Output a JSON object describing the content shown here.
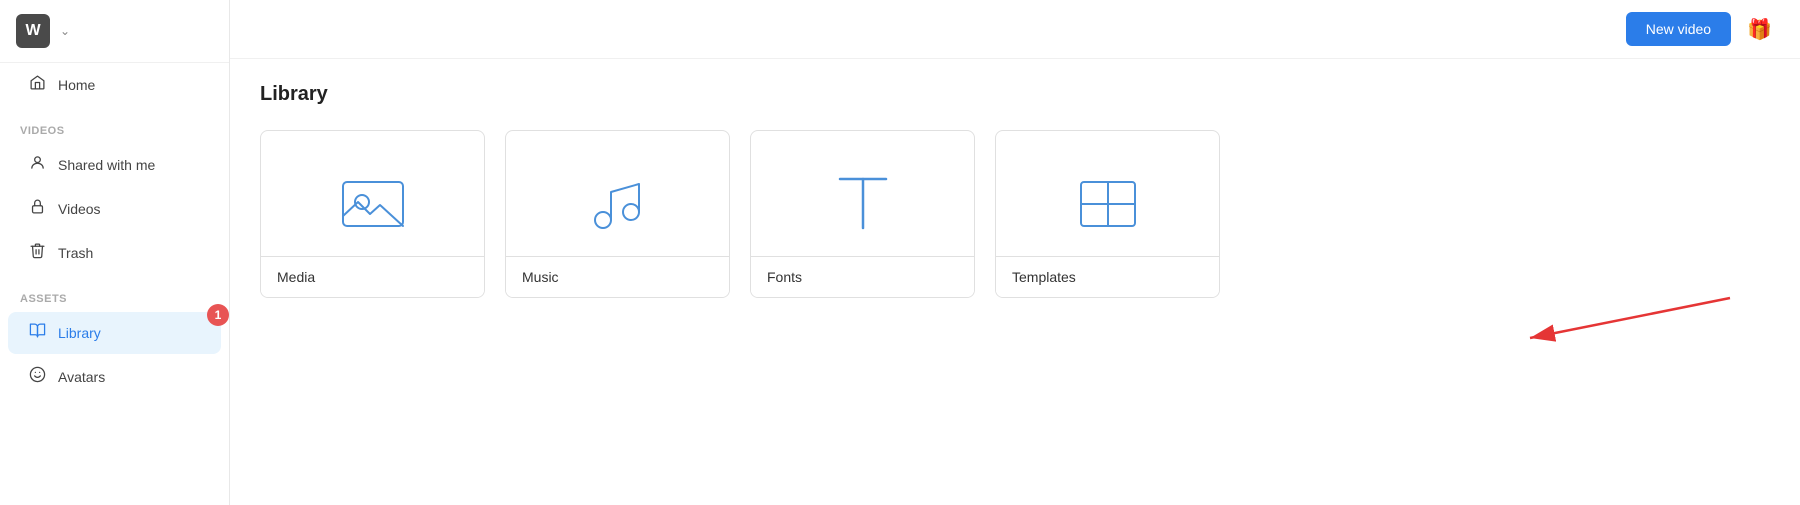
{
  "sidebar": {
    "logo": "W",
    "sections": [
      {
        "label": "",
        "items": [
          {
            "id": "home",
            "label": "Home",
            "icon": "home",
            "active": false
          }
        ]
      },
      {
        "label": "Videos",
        "items": [
          {
            "id": "shared-with-me",
            "label": "Shared with me",
            "icon": "person",
            "active": false
          },
          {
            "id": "videos",
            "label": "Videos",
            "icon": "lock",
            "active": false
          },
          {
            "id": "trash",
            "label": "Trash",
            "icon": "trash",
            "active": false
          }
        ]
      },
      {
        "label": "Assets",
        "items": [
          {
            "id": "library",
            "label": "Library",
            "icon": "book",
            "active": true,
            "badge": "1"
          },
          {
            "id": "avatars",
            "label": "Avatars",
            "icon": "smiley",
            "active": false
          }
        ]
      }
    ]
  },
  "topbar": {
    "new_video_label": "New video",
    "gift_icon": "🎁"
  },
  "main": {
    "page_title": "Library",
    "cards": [
      {
        "id": "media",
        "label": "Media"
      },
      {
        "id": "music",
        "label": "Music"
      },
      {
        "id": "fonts",
        "label": "Fonts"
      },
      {
        "id": "templates",
        "label": "Templates"
      }
    ]
  }
}
